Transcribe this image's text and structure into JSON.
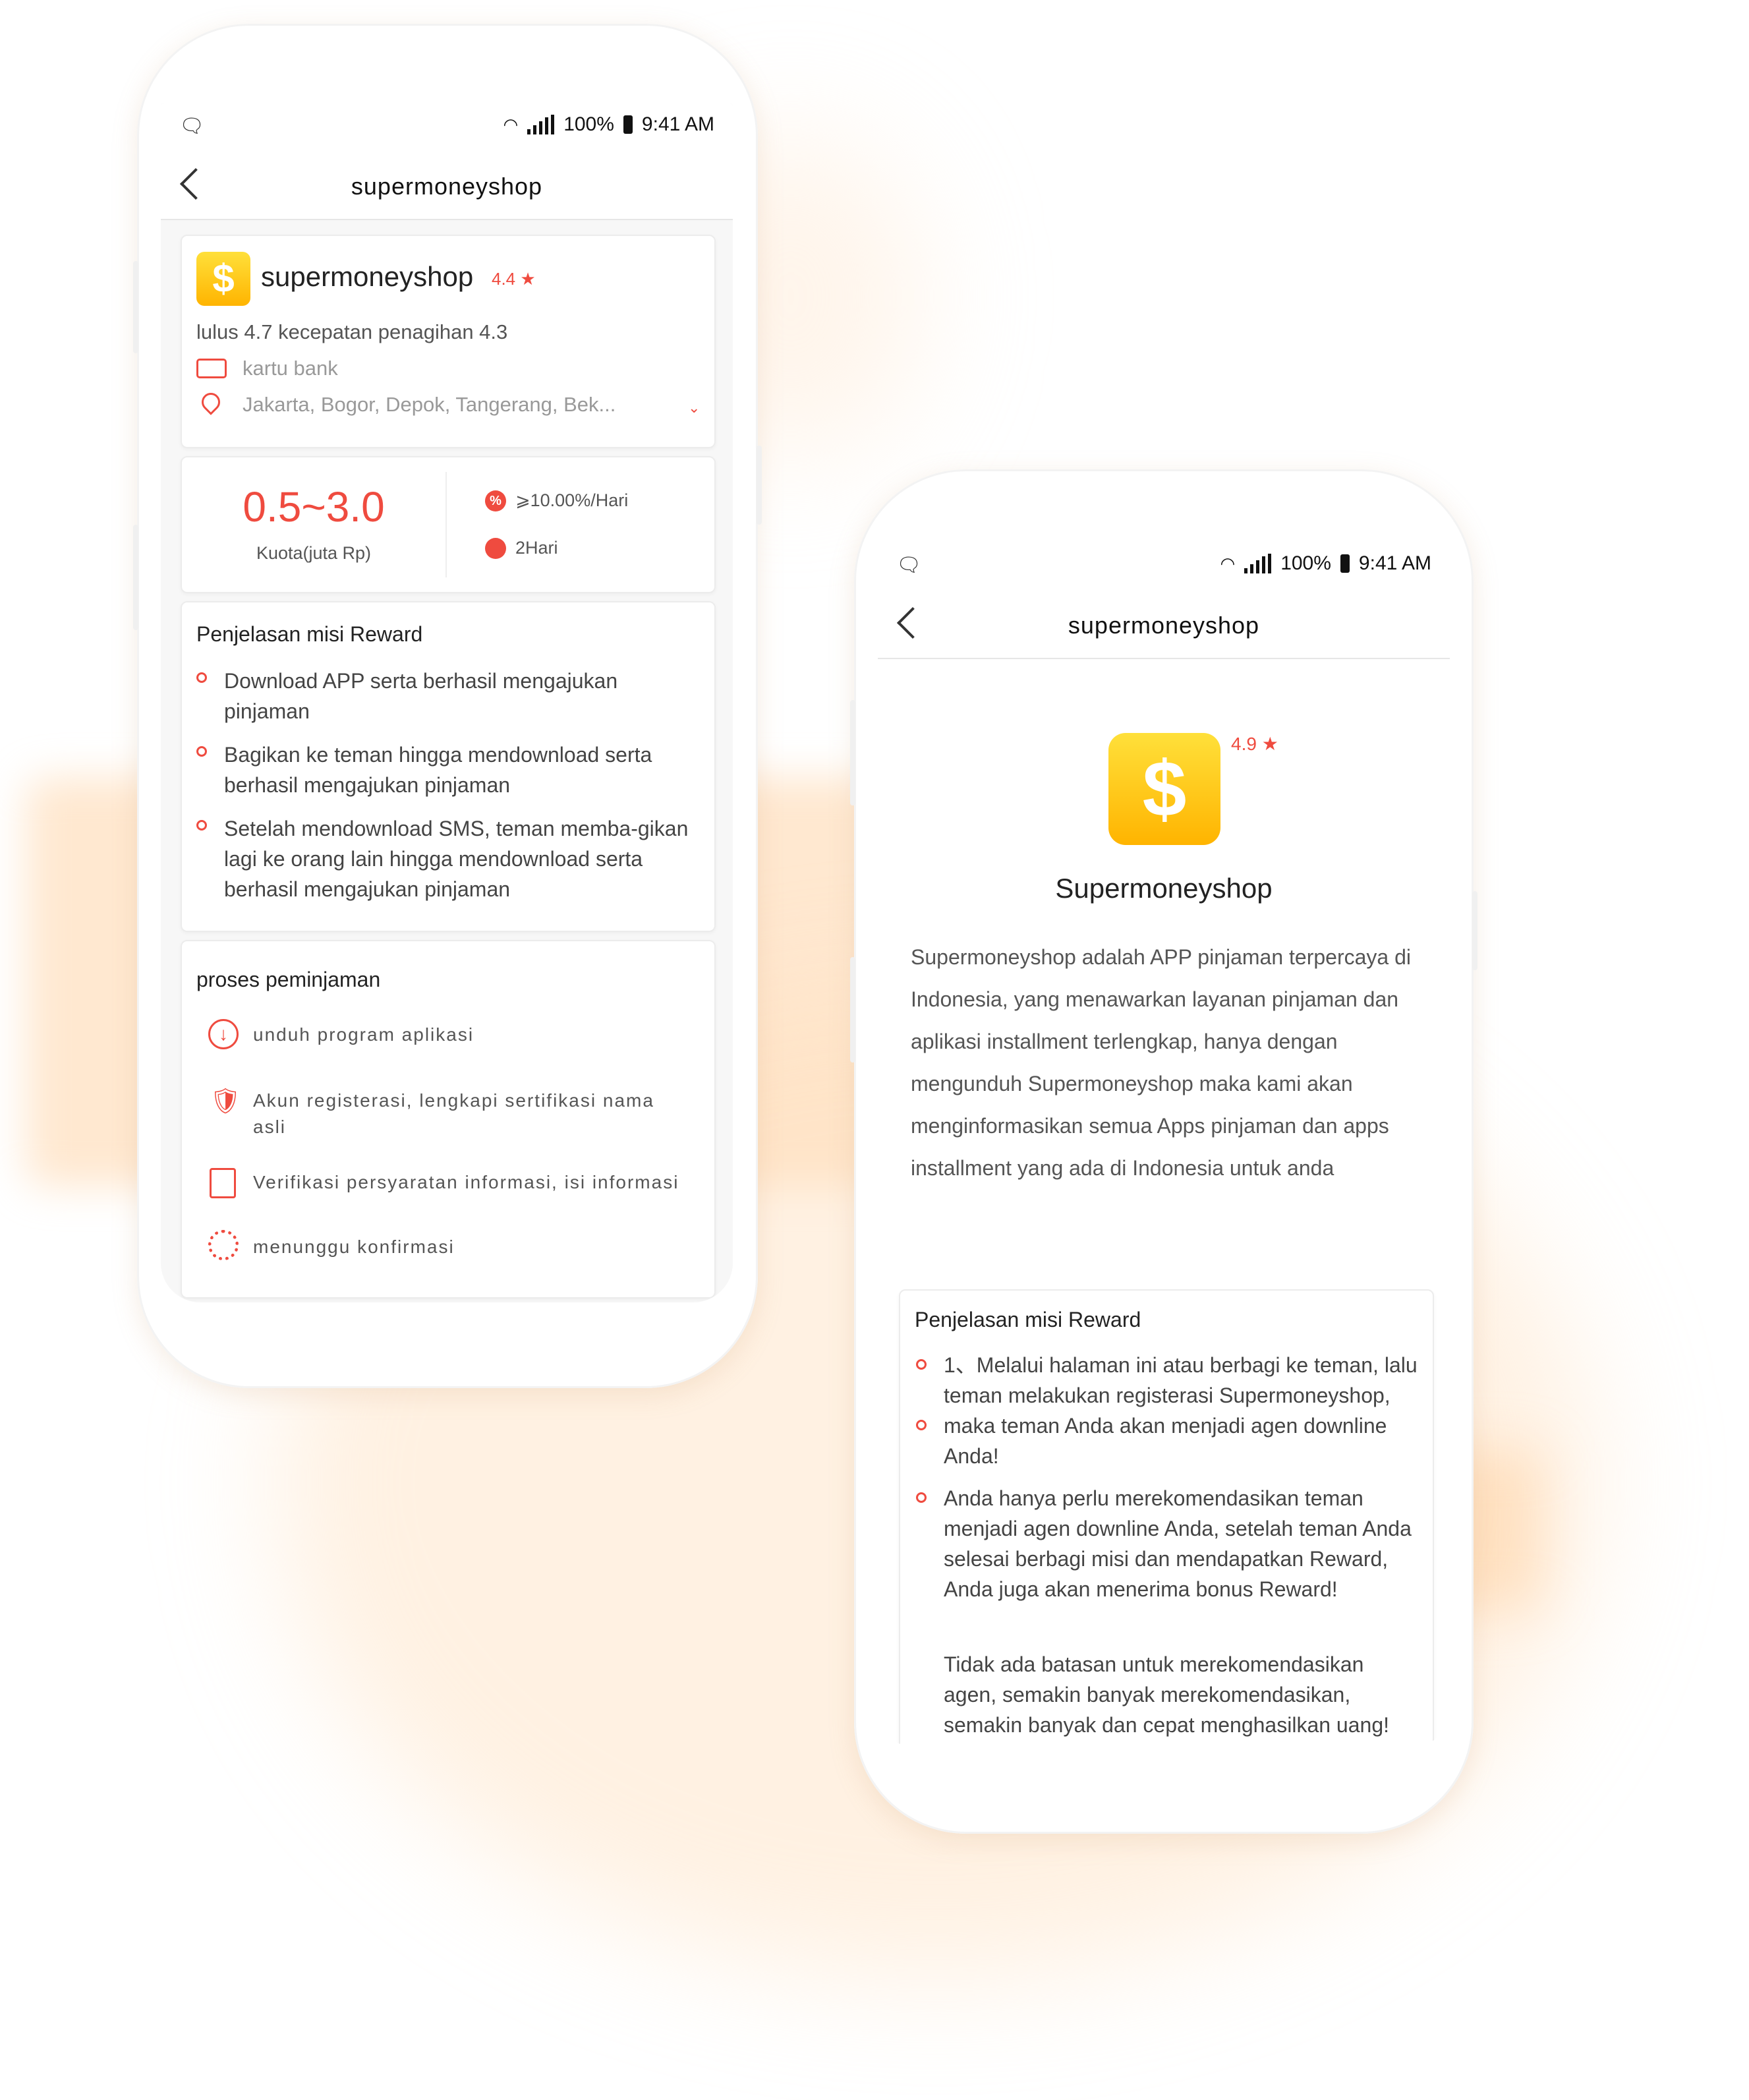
{
  "status": {
    "battery": "100%",
    "time": "9:41 AM"
  },
  "left": {
    "nav_title": "supermoneyshop",
    "app": {
      "name": "supermoneyshop",
      "rating": "4.4",
      "ratings_line": "lulus 4.7 kecepatan penagihan 4.3",
      "requirement": "kartu bank",
      "location": "Jakarta, Bogor, Depok, Tangerang, Bek..."
    },
    "quota": {
      "range": "0.5~3.0",
      "label": "Kuota(juta Rp)",
      "rate": "⩾10.00%/Hari",
      "term": "2Hari",
      "rate_icon": "%"
    },
    "reward": {
      "title": "Penjelasan misi Reward",
      "items": [
        "Download APP serta berhasil mengajukan pinjaman",
        "Bagikan ke teman hingga mendownload serta berhasil mengajukan pinjaman",
        "Setelah mendownload SMS, teman memba-gikan lagi ke orang lain hingga mendownload serta berhasil mengajukan pinjaman"
      ]
    },
    "process": {
      "title": "proses peminjaman",
      "steps": [
        "unduh program aplikasi",
        "Akun registerasi, lengkapi sertifikasi nama asli",
        "Verifikasi persyaratan informasi, isi informasi",
        "menunggu konfirmasi"
      ]
    }
  },
  "right": {
    "nav_title": "supermoneyshop",
    "app_name": "Supermoneyshop",
    "rating": "4.9",
    "description": "Supermoneyshop adalah APP pinjaman terpercaya di Indonesia, yang menawarkan layanan pinjaman dan aplikasi installment terlengkap, hanya dengan mengunduh Supermoneyshop maka kami akan menginformasikan semua Apps pinjaman dan apps installment yang ada di Indonesia untuk anda",
    "reward": {
      "title": "Penjelasan misi Reward",
      "item1": "1、Melalui halaman ini atau berbagi ke teman, lalu teman melakukan registerasi Supermoneyshop, maka teman Anda akan menjadi agen downline Anda!",
      "item2": "Anda hanya perlu merekomendasikan teman menjadi agen downline Anda, setelah teman Anda selesai berbagi misi dan mendapatkan Reward, Anda juga akan menerima bonus Reward!",
      "note": "Tidak ada batasan untuk merekomendasikan agen, semakin banyak merekomendasikan, semakin banyak dan cepat menghasilkan uang!"
    }
  }
}
